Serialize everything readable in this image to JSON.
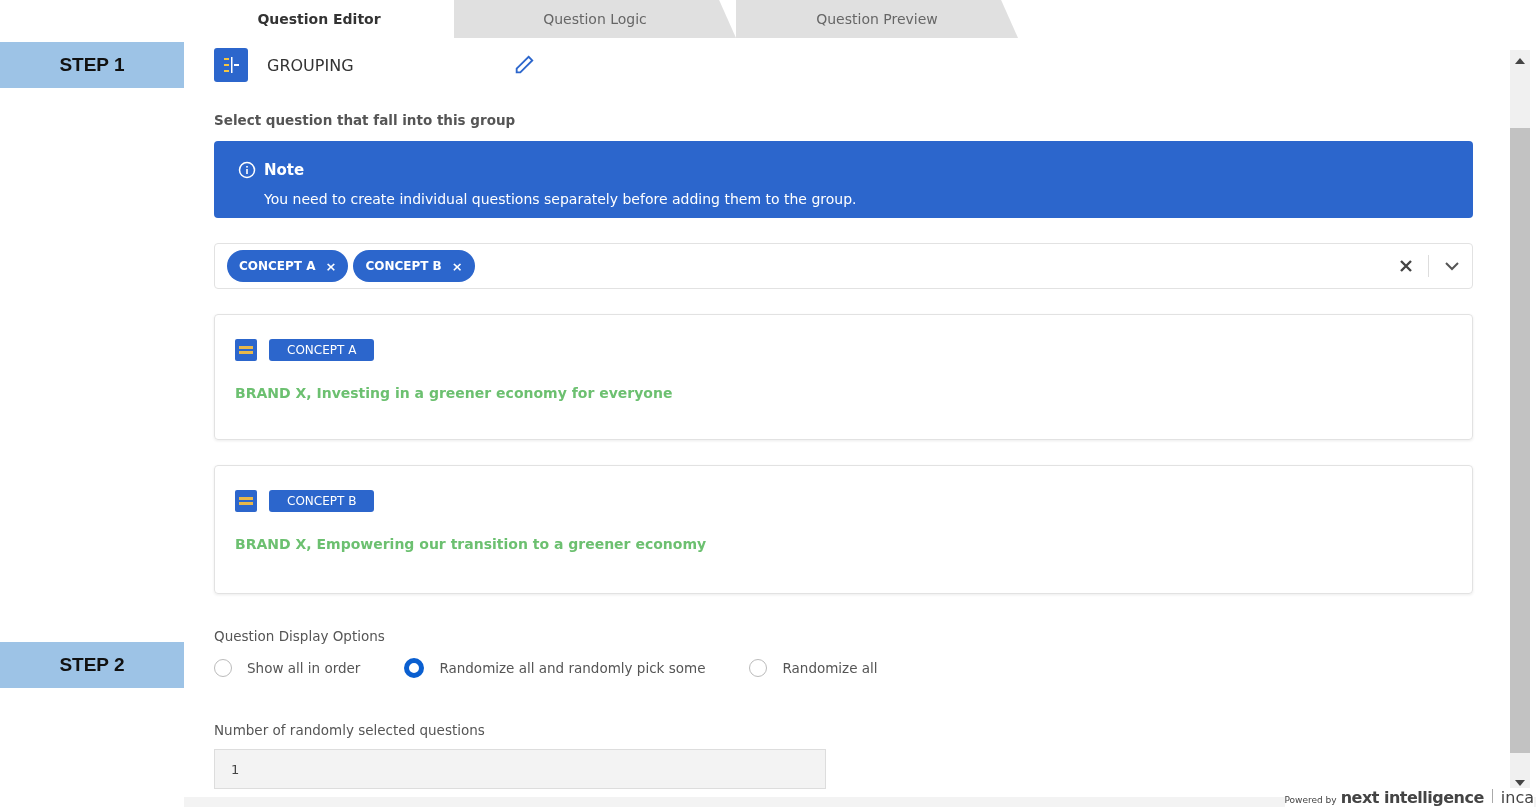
{
  "steps": [
    "STEP 1",
    "STEP 2"
  ],
  "tabs": [
    {
      "label": "Question Editor",
      "selected": true
    },
    {
      "label": "Question Logic",
      "selected": false
    },
    {
      "label": "Question Preview",
      "selected": false
    }
  ],
  "group": {
    "title": "GROUPING"
  },
  "select_label": "Select question that fall into this group",
  "note": {
    "title": "Note",
    "text": "You need to create individual questions separately before adding them to the group."
  },
  "selected_tags": [
    "CONCEPT A",
    "CONCEPT B"
  ],
  "tag_remove": "×",
  "cards": [
    {
      "tag": "CONCEPT A",
      "text": "BRAND X, Investing in a greener economy for everyone"
    },
    {
      "tag": "CONCEPT B",
      "text": "BRAND X, Empowering our transition to a greener economy"
    }
  ],
  "display_options": {
    "label": "Question Display Options",
    "options": [
      {
        "label": "Show all in order",
        "selected": false
      },
      {
        "label": "Randomize all and randomly pick some",
        "selected": true
      },
      {
        "label": "Randomize all",
        "selected": false
      }
    ]
  },
  "random_count": {
    "label": "Number of randomly selected questions",
    "value": "1"
  },
  "footer": {
    "powered": "Powered by",
    "brand": "next intelligence",
    "product": "inca"
  }
}
